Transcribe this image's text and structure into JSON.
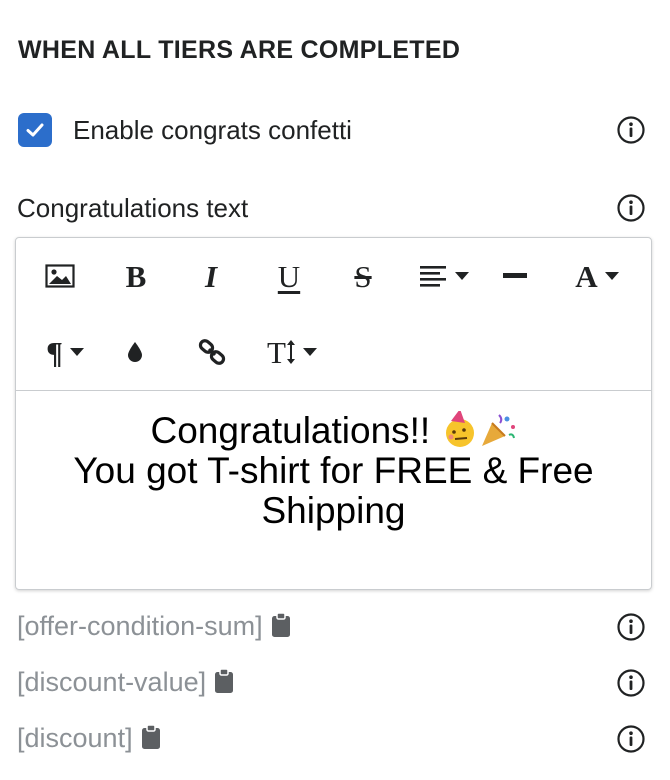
{
  "section": {
    "title": "WHEN ALL TIERS ARE COMPLETED"
  },
  "confetti": {
    "label": "Enable congrats confetti",
    "checked": true
  },
  "congrats_text": {
    "label": "Congratulations text",
    "content_line1": "Congratulations!!",
    "content_line2": "You got T-shirt for FREE & Free",
    "content_line3": "Shipping"
  },
  "toolbar": {
    "bold": "B",
    "italic": "I",
    "underline": "U",
    "strike": "S",
    "font_color": "A",
    "paragraph": "¶",
    "text_size": "T"
  },
  "variables": [
    {
      "label": "[offer-condition-sum]"
    },
    {
      "label": "[discount-value]"
    },
    {
      "label": "[discount]"
    }
  ],
  "colors": {
    "accent": "#2c6ecb",
    "muted_text": "#8c9196",
    "border": "#c9cccf"
  }
}
